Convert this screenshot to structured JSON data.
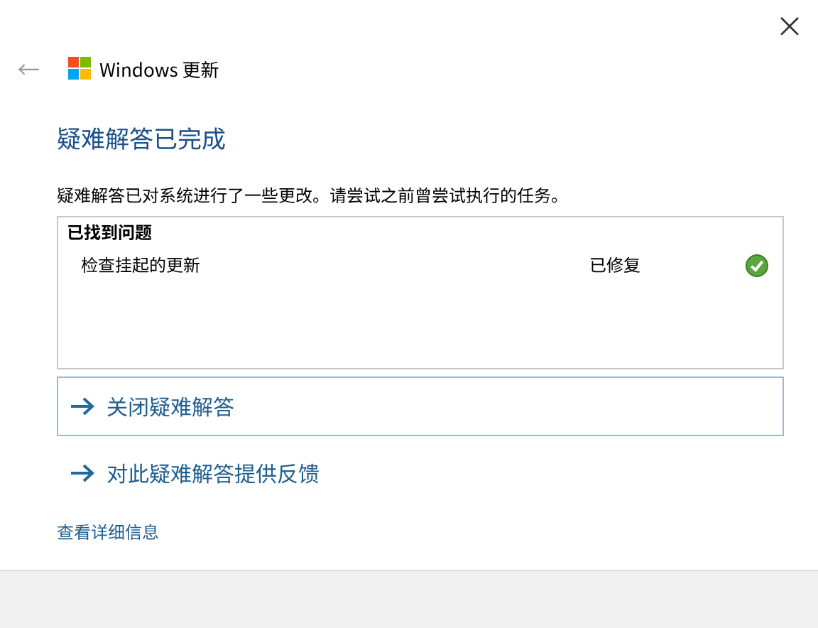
{
  "window": {
    "close": "×"
  },
  "header": {
    "back": "←",
    "title": "Windows 更新"
  },
  "heading": "疑难解答已完成",
  "description": "疑难解答已对系统进行了一些更改。请尝试之前曾尝试执行的任务。",
  "results": {
    "title": "已找到问题",
    "rows": [
      {
        "problem": "检查挂起的更新",
        "status": "已修复",
        "fixed": true
      }
    ]
  },
  "actions": [
    {
      "label": "关闭疑难解答",
      "focused": true
    },
    {
      "label": "对此疑难解答提供反馈",
      "focused": false
    }
  ],
  "details_link": "查看详细信息"
}
